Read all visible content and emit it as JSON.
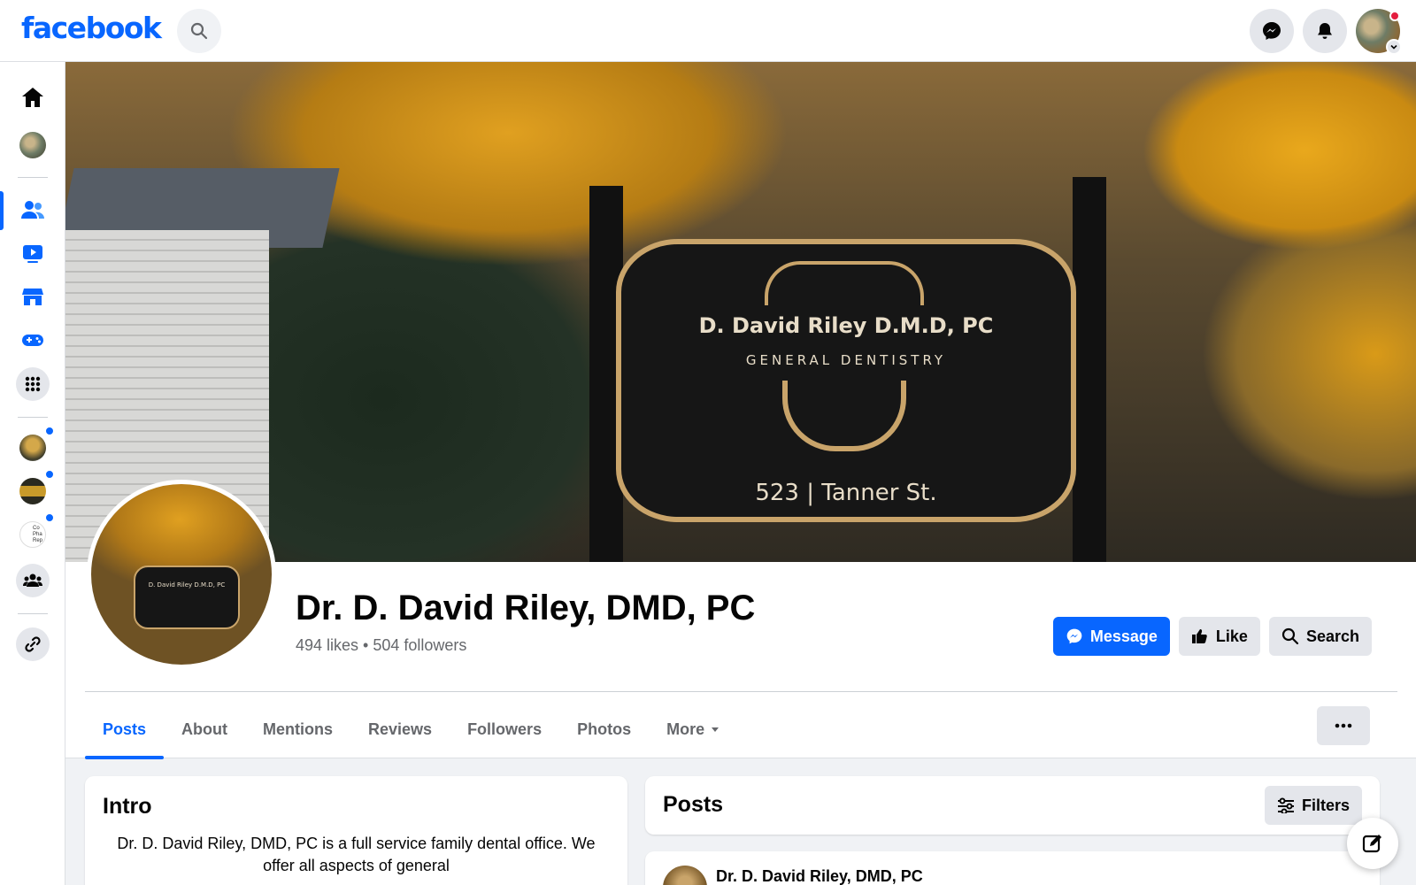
{
  "topbar": {
    "logo": "facebook",
    "icons": [
      "search-icon",
      "messenger-icon",
      "notifications-icon",
      "account-avatar"
    ]
  },
  "rail": {
    "items": [
      {
        "name": "home",
        "icon": "home-icon"
      },
      {
        "name": "profile",
        "icon": "avatar"
      },
      {
        "name": "friends",
        "icon": "friends-icon",
        "active": true
      },
      {
        "name": "watch",
        "icon": "video-icon"
      },
      {
        "name": "marketplace",
        "icon": "store-icon"
      },
      {
        "name": "gaming",
        "icon": "game-controller-icon"
      },
      {
        "name": "menu",
        "icon": "grid-icon"
      },
      {
        "name": "shortcut-1",
        "icon": "page-thumbnail",
        "badge": true
      },
      {
        "name": "shortcut-2",
        "icon": "page-thumbnail",
        "badge": true
      },
      {
        "name": "shortcut-3",
        "icon": "page-thumbnail",
        "badge": true,
        "label": "Co Pha Rep"
      },
      {
        "name": "groups",
        "icon": "groups-icon"
      },
      {
        "name": "link",
        "icon": "link-icon"
      }
    ]
  },
  "cover": {
    "sign_line1": "D. David Riley D.M.D, PC",
    "sign_line2": "GENERAL DENTISTRY",
    "sign_line3": "523 | Tanner St."
  },
  "profile": {
    "name": "Dr. D. David Riley, DMD, PC",
    "stats": "494 likes • 504 followers",
    "pic_text": "D. David Riley D.M.D, PC"
  },
  "actions": {
    "message": "Message",
    "like": "Like",
    "search": "Search"
  },
  "tabs": [
    "Posts",
    "About",
    "Mentions",
    "Reviews",
    "Followers",
    "Photos",
    "More"
  ],
  "intro": {
    "title": "Intro",
    "text": "Dr. D. David Riley, DMD, PC is a full service family dental office. We offer all aspects of general"
  },
  "posts": {
    "title": "Posts",
    "filters": "Filters",
    "first_author": "Dr. D. David Riley, DMD, PC"
  },
  "colors": {
    "brand": "#0866ff",
    "background": "#f0f2f5",
    "secondary_button": "#e4e6eb",
    "notification_dot": "#e41e3f"
  }
}
